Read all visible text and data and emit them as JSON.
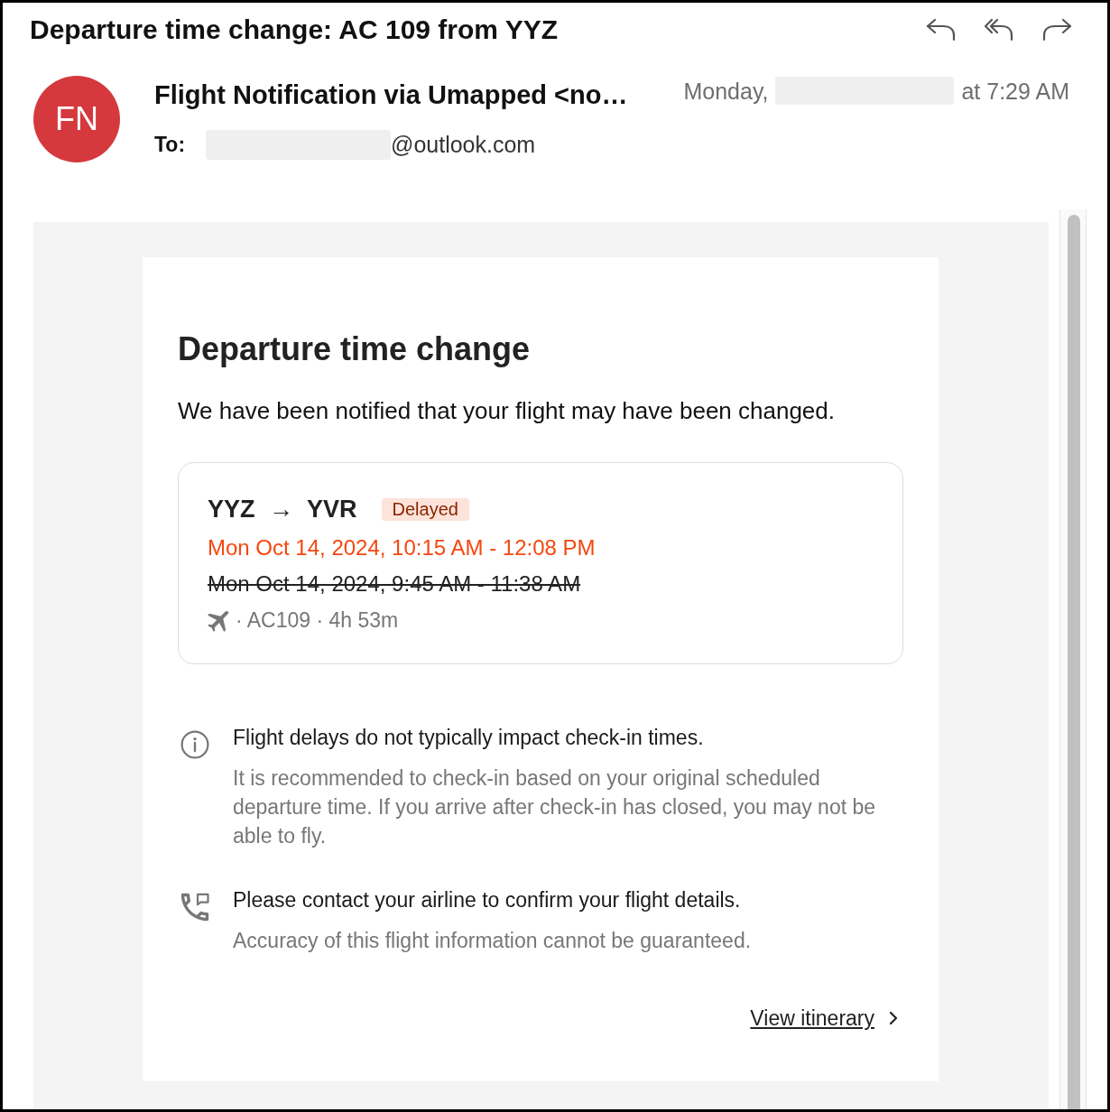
{
  "message": {
    "subject": "Departure time change: AC 109 from YYZ"
  },
  "sender": {
    "initials": "FN",
    "name": "Flight Notification via Umapped <no…",
    "date_prefix": "Monday,",
    "time": "at 7:29 AM"
  },
  "recipient": {
    "label": "To:",
    "address": "@outlook.com"
  },
  "email_body": {
    "heading": "Departure time change",
    "intro": "We have been notified that your flight may have been changed.",
    "flight": {
      "route": "YYZ → YVR",
      "status": "Delayed",
      "times": [
        {
          "kind": "new",
          "text": "Mon Oct 14, 2024, 10:15 AM - 12:08 PM"
        },
        {
          "kind": "previous",
          "text": "Mon Oct 14, 2024, 9:45 AM - 11:38 AM"
        }
      ],
      "details": "· AC109 · 4h 53m"
    },
    "notes": [
      {
        "kind": "info",
        "title": "Flight delays do not typically impact check-in times.",
        "text": "It is recommended to check-in based on your original scheduled departure time. If you arrive after check-in has closed, you may not be able to fly."
      },
      {
        "kind": "phone",
        "title": "Please contact your airline to confirm your flight details.",
        "text": "Accuracy of this flight information cannot be guaranteed."
      }
    ],
    "link": "View itinerary"
  }
}
